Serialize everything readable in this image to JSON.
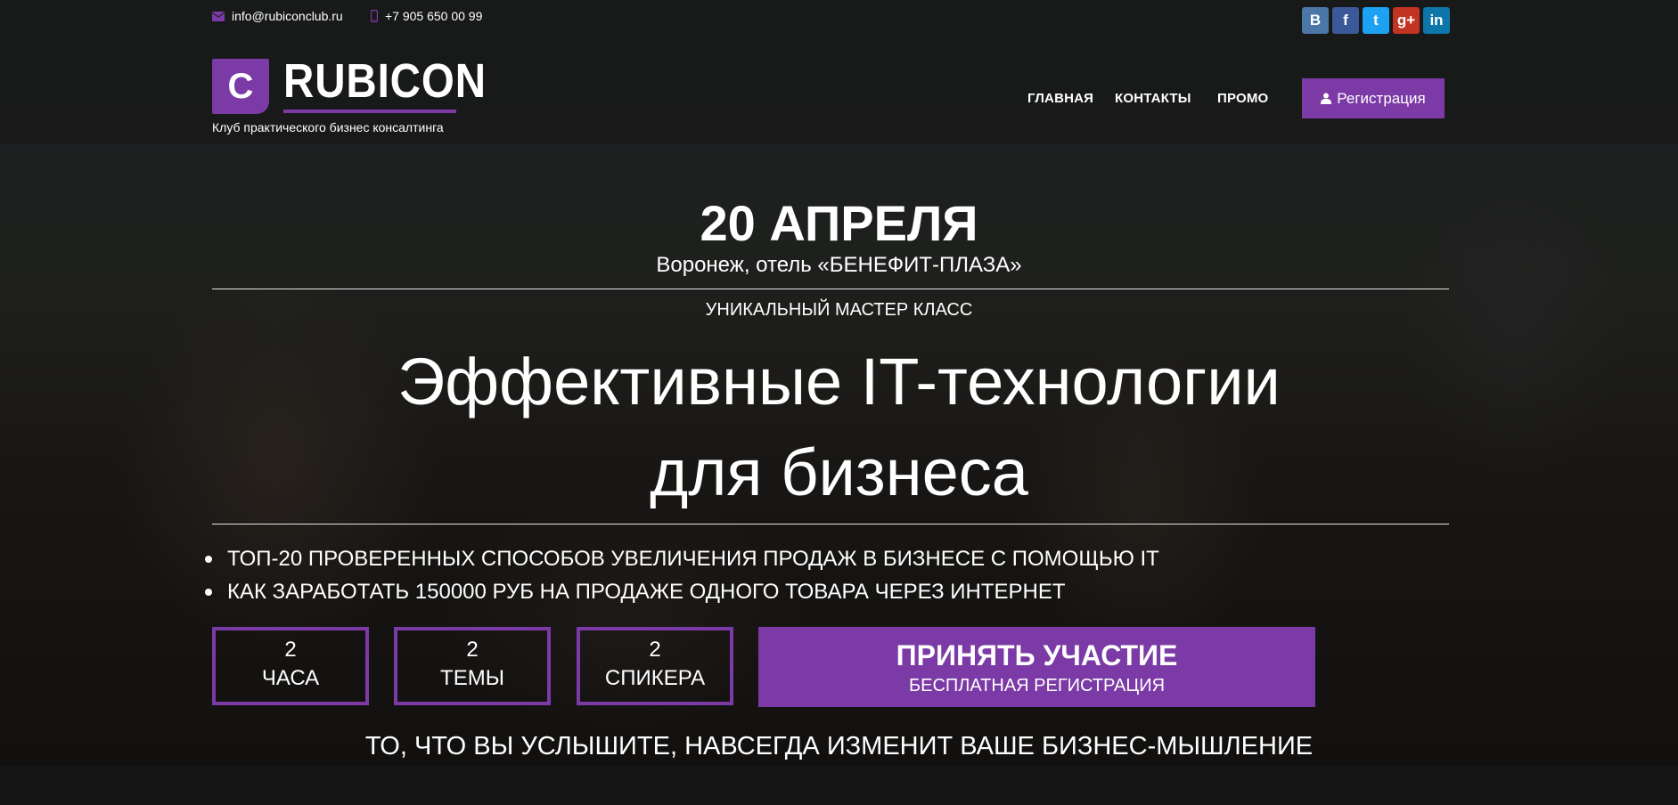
{
  "header": {
    "email": "info@rubiconclub.ru",
    "phone": "+7 905 650 00 99",
    "social": [
      {
        "label": "В",
        "name": "vk",
        "color": "#4a76a8"
      },
      {
        "label": "f",
        "name": "facebook",
        "color": "#3b5998"
      },
      {
        "label": "t",
        "name": "twitter",
        "color": "#1da1f2"
      },
      {
        "label": "g+",
        "name": "google-plus",
        "color": "#c23321"
      },
      {
        "label": "in",
        "name": "linkedin",
        "color": "#0e76a8"
      }
    ],
    "logo_letter": "C",
    "logo_name": "RUBICON",
    "logo_tagline": "Клуб практического бизнес консалтинга",
    "nav": [
      "ГЛАВНАЯ",
      "КОНТАКТЫ",
      "ПРОМО"
    ],
    "register_label": "Регистрация",
    "accent": "#7b3aa5"
  },
  "hero": {
    "date": "20 АПРЕЛЯ",
    "venue": "Воронеж, отель «БЕНЕФИТ-ПЛАЗА»",
    "kicker": "УНИКАЛЬНЫЙ МАСТЕР КЛАСС",
    "title_line1": "Эффективные IT-технологии",
    "title_line2": "для бизнеса",
    "bullets": [
      "ТОП-20 ПРОВЕРЕННЫХ СПОСОБОВ УВЕЛИЧЕНИЯ ПРОДАЖ В БИЗНЕСЕ С ПОМОЩЬЮ IT",
      "КАК ЗАРАБОТАТЬ 150000 РУБ НА ПРОДАЖЕ ОДНОГО ТОВАРА ЧЕРЕЗ ИНТЕРНЕТ"
    ],
    "stats": [
      {
        "number": "2",
        "label": "ЧАСА"
      },
      {
        "number": "2",
        "label": "ТЕМЫ"
      },
      {
        "number": "2",
        "label": "СПИКЕРА"
      }
    ],
    "cta_title": "ПРИНЯТЬ УЧАСТИЕ",
    "cta_subtitle": "БЕСПЛАТНАЯ РЕГИСТРАЦИЯ",
    "bottom_text": "ТО, ЧТО ВЫ УСЛЫШИТЕ, НАВСЕГДА ИЗМЕНИТ ВАШЕ БИЗНЕС-МЫШЛЕНИЕ"
  }
}
